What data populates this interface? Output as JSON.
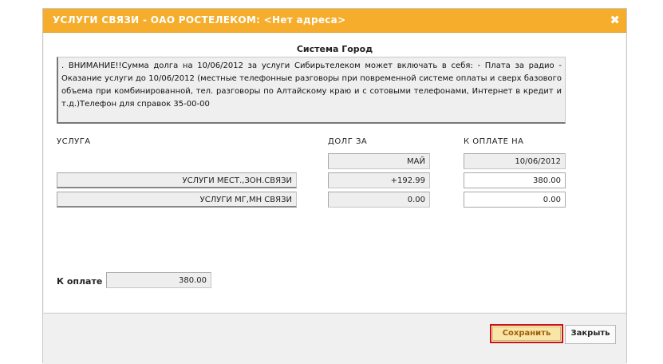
{
  "dialog": {
    "title": "УСЛУГИ СВЯЗИ - ОАО РОСТЕЛЕКОМ: <Нет адреса>",
    "close_glyph": "✖"
  },
  "main": {
    "system_title": "Система Город",
    "notice": ".                        ВНИМАНИЕ!!Сумма долга на 10/06/2012 за услуги Сибирьтелеком может включать в себя:  - Плата за радио  - Оказание услуги до 10/06/2012 (местные телефонные разговоры при повременной системе оплаты и   сверх базового объема при комбинированной, тел. разговоры по Алтайскому краю и с сотовыми   телефонами, Интернет в кредит и т.д.)Телефон для справок 35-00-00",
    "columns": {
      "service": "УСЛУГА",
      "debt": "ДОЛГ ЗА",
      "pay": "К ОПЛАТЕ НА"
    },
    "debt_period": "МАЙ",
    "pay_date": "10/06/2012",
    "rows": [
      {
        "service": "УСЛУГИ МЕСТ.,ЗОН.СВЯЗИ",
        "debt": "+192.99",
        "pay": "380.00"
      },
      {
        "service": "УСЛУГИ МГ,МН СВЯЗИ",
        "debt": "0.00",
        "pay": "0.00"
      }
    ],
    "total_label": "К оплате",
    "total_value": "380.00"
  },
  "footer": {
    "save_label": "Сохранить",
    "close_label": "Закрыть"
  },
  "colors": {
    "titlebar": "#f6ad2b",
    "save_highlight": "#cc1111"
  },
  "icons": {
    "close": "close-icon"
  }
}
